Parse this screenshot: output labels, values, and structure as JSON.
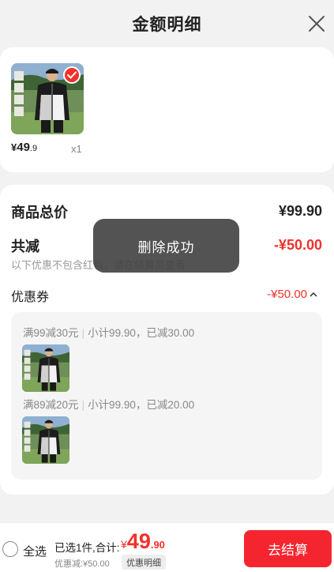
{
  "header": {
    "title": "金额明细"
  },
  "product": {
    "price_symbol": "¥",
    "price_int": "49",
    "price_dec": ".9",
    "quantity": "x1"
  },
  "detail": {
    "goods_total_label": "商品总价",
    "goods_total_value": "¥99.90",
    "reduction_label": "共减",
    "reduction_value": "-¥50.00",
    "reduction_note": "以下优惠不包含红包，请在结算页查看",
    "coupon_label": "优惠券",
    "coupon_value": "-¥50.00",
    "rules": [
      {
        "condition": "满99减30元",
        "summary": "小计99.90，已减30.00"
      },
      {
        "condition": "满89减20元",
        "summary": "小计99.90，已减20.00"
      }
    ]
  },
  "toast": {
    "message": "删除成功"
  },
  "footer": {
    "select_all": "全选",
    "selected_text": "已选1件,合计:",
    "total_symbol": "¥",
    "total_int": "49",
    "total_dec": ".90",
    "discount_note": "优惠减:¥50.00",
    "detail_link": "优惠明细",
    "checkout_label": "去结算"
  },
  "colors": {
    "accent": "#f0322a",
    "checkout_bg": "#f5252f",
    "toast_bg": "#404040"
  },
  "icons": {
    "close": "close-icon",
    "selected": "check-icon",
    "expand": "chevron-up-icon"
  }
}
